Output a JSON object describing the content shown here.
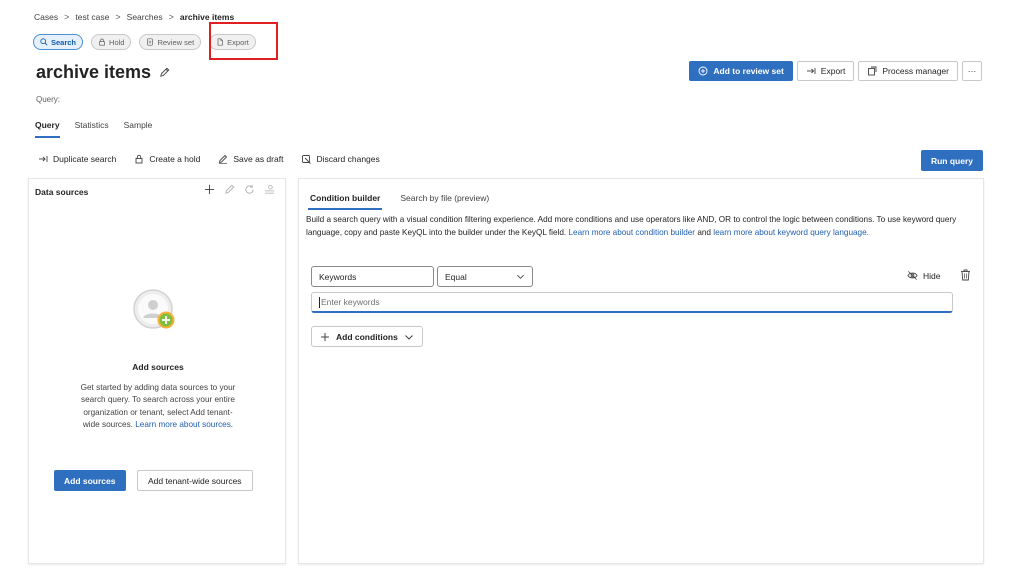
{
  "breadcrumb": {
    "items": [
      "Cases",
      "test case",
      "Searches"
    ],
    "current": "archive items",
    "separator": ">"
  },
  "stages": {
    "search": "Search",
    "hold": "Hold",
    "review_set": "Review set",
    "export": "Export"
  },
  "page": {
    "title": "archive items",
    "query_label": "Query:"
  },
  "top_actions": {
    "add_to_review_set": "Add to review set",
    "export": "Export",
    "process_manager": "Process manager",
    "more": "···"
  },
  "tabs": {
    "query": "Query",
    "statistics": "Statistics",
    "sample": "Sample"
  },
  "toolbar": {
    "duplicate_search": "Duplicate search",
    "create_hold": "Create a hold",
    "save_as_draft": "Save as draft",
    "discard_changes": "Discard changes",
    "run_query": "Run query"
  },
  "data_sources": {
    "title": "Data sources",
    "empty_title": "Add sources",
    "empty_desc": "Get started by adding data sources to your search query. To search across your entire organization or tenant, select Add tenant-wide sources.",
    "learn_more": "Learn more about sources.",
    "add_sources": "Add sources",
    "add_tenant_wide": "Add tenant-wide sources"
  },
  "builder": {
    "tab_condition_builder": "Condition builder",
    "tab_search_by_file": "Search by file (preview)",
    "desc_prefix": "Build a search query with a visual condition filtering experience. Add more conditions and use operators like AND, OR to control the logic between conditions. To use keyword query language, copy and paste KeyQL into the builder under the KeyQL field.",
    "link_condition_builder": "Learn more about condition builder",
    "desc_and": "and",
    "link_keyword_query": "learn more about keyword query language.",
    "keywords_field": "Keywords",
    "operator": "Equal",
    "hide": "Hide",
    "keywords_placeholder": "Enter keywords",
    "add_conditions": "Add conditions"
  },
  "colors": {
    "accent": "#2f6fbf",
    "highlight": "#e02020",
    "link": "#1f5fb0"
  }
}
